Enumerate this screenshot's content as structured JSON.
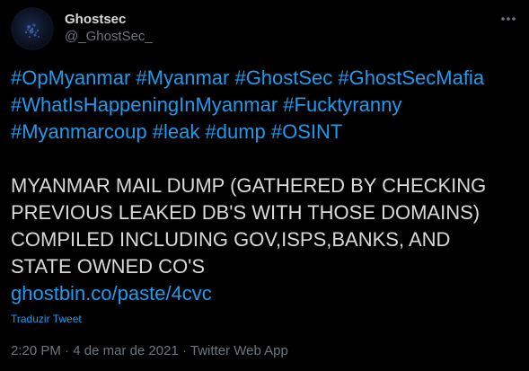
{
  "author": {
    "display_name": "Ghostsec",
    "handle": "@_GhostSec_"
  },
  "hashtags": [
    "#OpMyanmar",
    "#Myanmar",
    "#GhostSec",
    "#GhostSecMafia",
    "#WhatIsHappeningInMyanmar",
    "#Fucktyranny",
    "#Myanmarcoup",
    "#leak",
    "#dump",
    "#OSINT"
  ],
  "content": {
    "lines": [
      "MYANMAR MAIL DUMP (GATHERED BY CHECKING",
      "PREVIOUS LEAKED DB'S WITH THOSE DOMAINS)",
      "COMPILED INCLUDING GOV,ISPS,BANKS, AND",
      "STATE OWNED CO'S"
    ],
    "link": "ghostbin.co/paste/4cvc"
  },
  "translate_label": "Traduzir Tweet",
  "meta": {
    "time": "2:20 PM",
    "separator": "·",
    "date": "4 de mar de 2021",
    "source": "Twitter Web App"
  },
  "colors": {
    "background": "#000000",
    "text": "#d9d9d9",
    "link": "#1d9bf0",
    "muted": "#6e767d"
  },
  "icons": {
    "more": "more-dots-icon",
    "avatar": "avatar"
  }
}
